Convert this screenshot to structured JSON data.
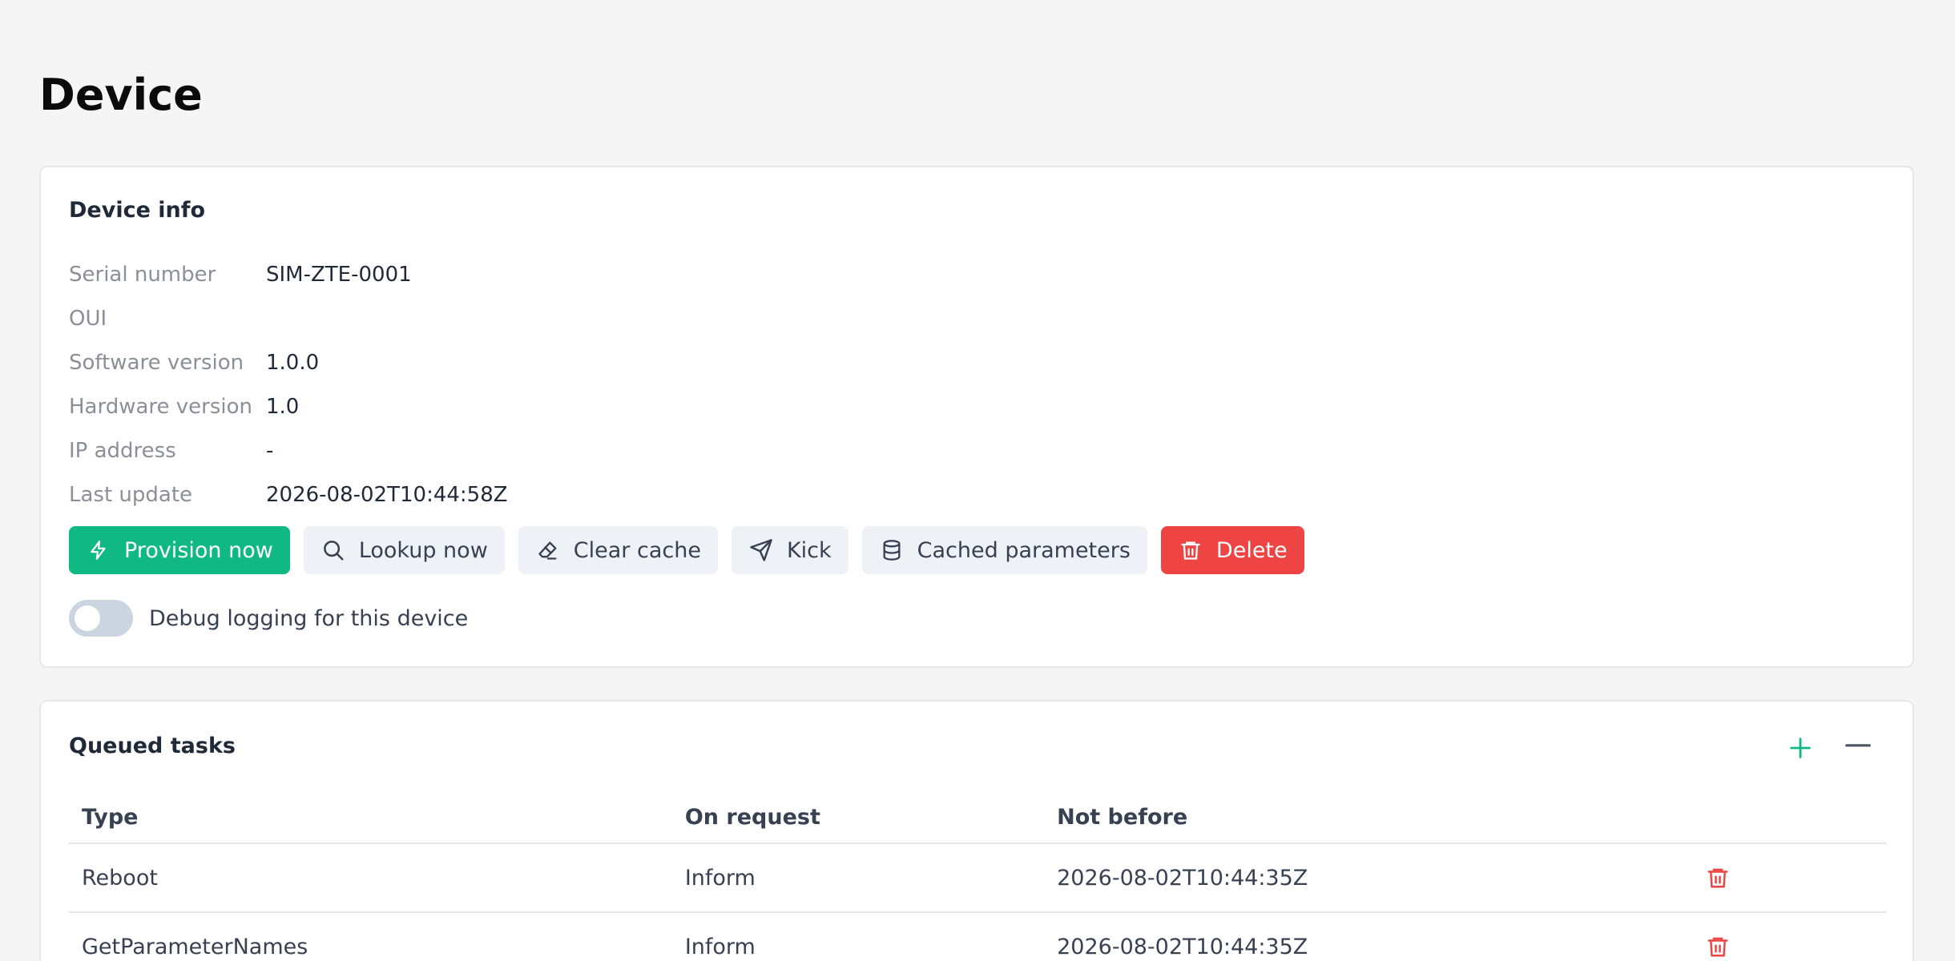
{
  "page": {
    "title": "Device"
  },
  "device_info": {
    "title": "Device info",
    "fields": [
      {
        "label": "Serial number",
        "value": "SIM-ZTE-0001"
      },
      {
        "label": "OUI",
        "value": ""
      },
      {
        "label": "Software version",
        "value": "1.0.0"
      },
      {
        "label": "Hardware version",
        "value": "1.0"
      },
      {
        "label": "IP address",
        "value": "-"
      },
      {
        "label": "Last update",
        "value": "2026-08-02T10:44:58Z"
      }
    ],
    "actions": {
      "provision": {
        "label": "Provision now",
        "icon": "lightning-icon"
      },
      "lookup": {
        "label": "Lookup now",
        "icon": "search-icon"
      },
      "clear_cache": {
        "label": "Clear cache",
        "icon": "eraser-icon"
      },
      "kick": {
        "label": "Kick",
        "icon": "send-icon"
      },
      "cached_params": {
        "label": "Cached parameters",
        "icon": "database-icon"
      },
      "delete": {
        "label": "Delete",
        "icon": "trash-icon"
      }
    },
    "debug_toggle": {
      "label": "Debug logging for this device",
      "enabled": false
    }
  },
  "queued_tasks": {
    "title": "Queued tasks",
    "columns": [
      "Type",
      "On request",
      "Not before"
    ],
    "rows": [
      {
        "type": "Reboot",
        "on_request": "Inform",
        "not_before": "2026-08-02T10:44:35Z"
      },
      {
        "type": "GetParameterNames",
        "on_request": "Inform",
        "not_before": "2026-08-02T10:44:35Z"
      }
    ]
  },
  "colors": {
    "primary": "#10b981",
    "danger": "#ef4444",
    "background": "#f5f5f5"
  }
}
